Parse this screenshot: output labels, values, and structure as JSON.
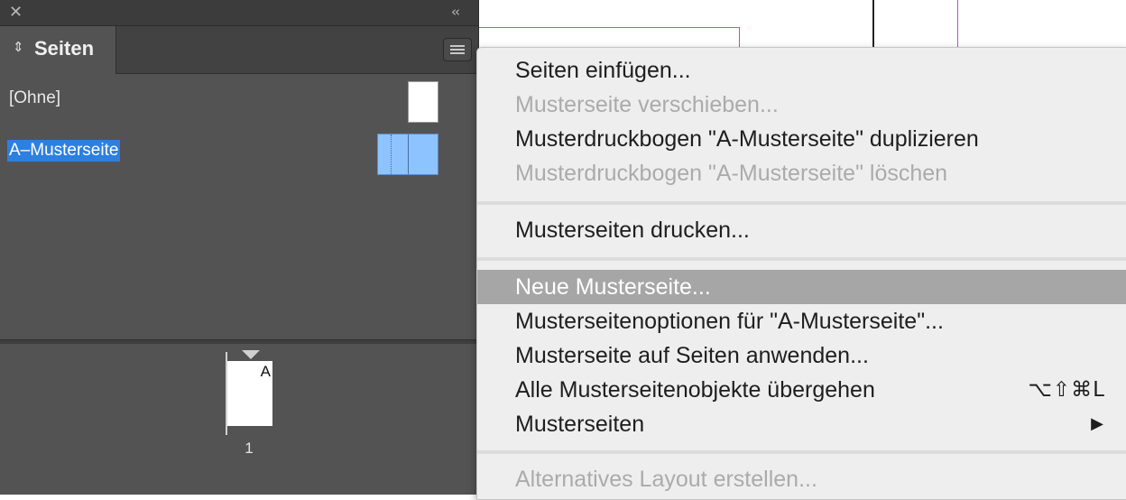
{
  "panel": {
    "tab_label": "Seiten",
    "masters": [
      {
        "label": "[Ohne]",
        "selected": false
      },
      {
        "label": "A–Musterseite",
        "selected": true
      }
    ],
    "pages": [
      {
        "number": "1",
        "master_prefix": "A"
      }
    ]
  },
  "menu": {
    "items": [
      {
        "label": "Seiten einfügen...",
        "enabled": true
      },
      {
        "label": "Musterseite verschieben...",
        "enabled": false
      },
      {
        "label": "Musterdruckbogen \"A-Musterseite\" duplizieren",
        "enabled": true
      },
      {
        "label": "Musterdruckbogen \"A-Musterseite\" löschen",
        "enabled": false
      },
      {
        "label": "Musterseiten drucken...",
        "enabled": true
      },
      {
        "label": "Neue Musterseite...",
        "enabled": true,
        "highlighted": true
      },
      {
        "label": "Musterseitenoptionen für \"A-Musterseite\"...",
        "enabled": true
      },
      {
        "label": "Musterseite auf Seiten anwenden...",
        "enabled": true
      },
      {
        "label": "Alle Musterseitenobjekte übergehen",
        "enabled": true,
        "shortcut": "⌥⇧⌘L"
      },
      {
        "label": "Musterseiten",
        "enabled": true,
        "submenu": true
      },
      {
        "label": "Alternatives Layout erstellen...",
        "enabled": false
      }
    ]
  },
  "colors": {
    "selection": "#2d7fe0",
    "menu_highlight": "#a6a6a6",
    "guide": "#c04ad8"
  }
}
